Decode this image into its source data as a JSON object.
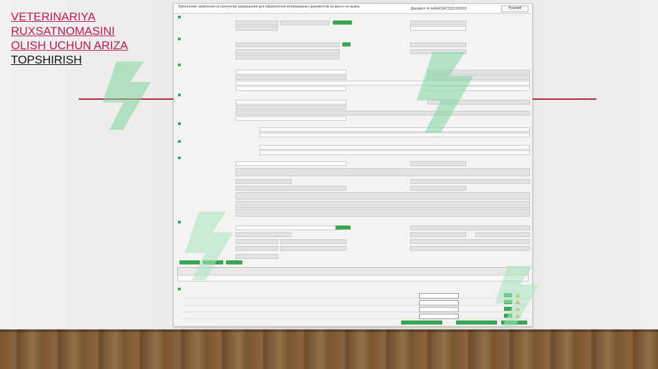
{
  "slide": {
    "title_lines": [
      "VETERINARIYA",
      "RUXSATNOMASINI",
      "OLISH UCHUN ARIZA"
    ],
    "title_last": "TOPSHIRISH"
  },
  "document": {
    "header_title": "Заполнение заявления на получение разрешения для оформления ветеринарных документов на ввоз и на вывоз",
    "doc_number": "Документ А №А4419472315100022",
    "language": "Русский"
  },
  "colors": {
    "title_link": "#c2185b",
    "rule": "#b0243e",
    "accent_green": "#3aa655",
    "warning": "#f0a020"
  }
}
